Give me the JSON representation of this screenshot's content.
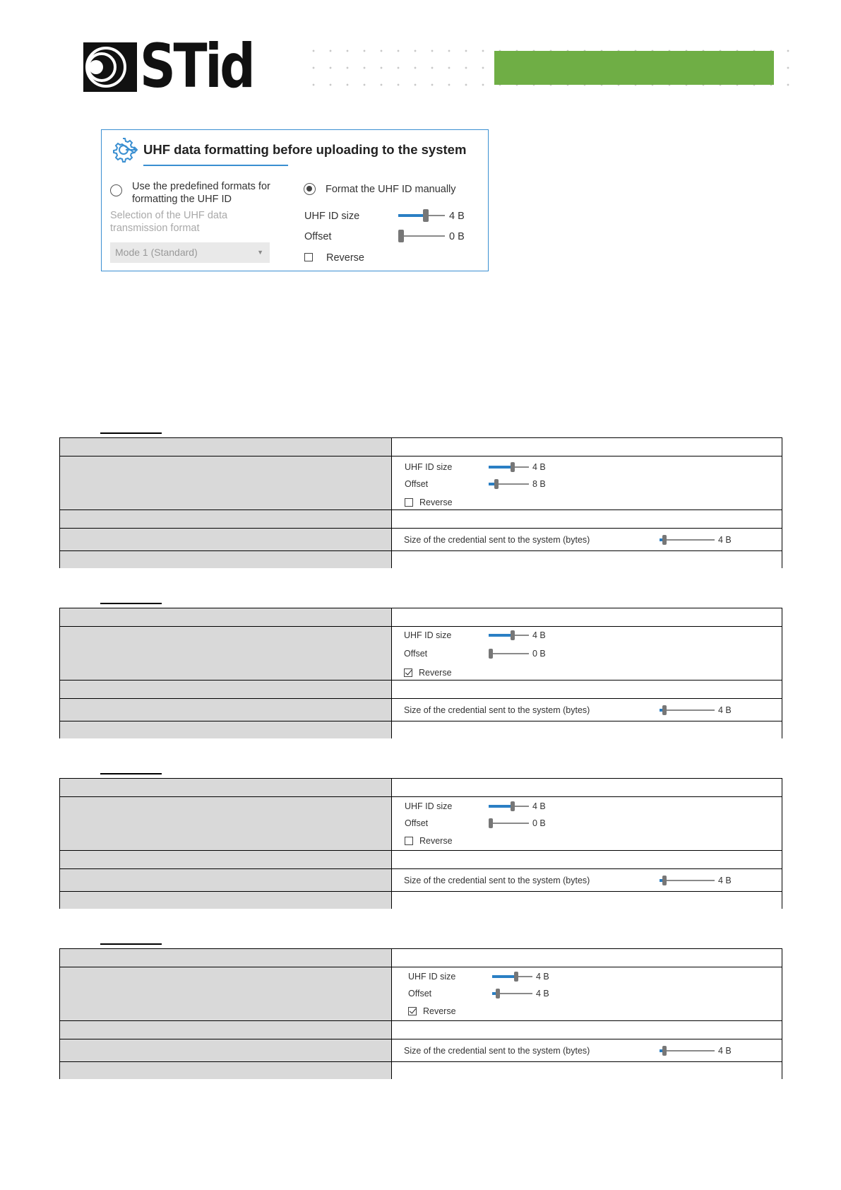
{
  "header": {
    "logo_text": "STid",
    "accent_color": "#6fae45"
  },
  "panel": {
    "title": "UHF data formatting before uploading to the system",
    "option_predefined": "Use the predefined formats for formatting the UHF ID",
    "option_manual": "Format the UHF ID manually",
    "selected_option": "manual",
    "selection_label": "Selection of the UHF data transmission format",
    "mode_value": "Mode 1 (Standard)",
    "uhf_id_size_label": "UHF ID size",
    "uhf_id_size_value": "4 B",
    "uhf_id_size_fraction": 0.6,
    "offset_label": "Offset",
    "offset_value": "0 B",
    "offset_fraction": 0.0,
    "reverse_label": "Reverse",
    "reverse_checked": false,
    "border_color": "#3a8fd1"
  },
  "tables": [
    {
      "uhf_id_size_label": "UHF ID size",
      "uhf_id_size_value": "4 B",
      "uhf_id_size_fraction": 0.6,
      "offset_label": "Offset",
      "offset_value": "8 B",
      "offset_fraction": 0.15,
      "reverse_label": "Reverse",
      "reverse_checked": false,
      "credential_label": "Size of the credential sent to the system (bytes)",
      "credential_value": "4 B",
      "credential_fraction": 0.05
    },
    {
      "uhf_id_size_label": "UHF ID size",
      "uhf_id_size_value": "4 B",
      "uhf_id_size_fraction": 0.6,
      "offset_label": "Offset",
      "offset_value": "0 B",
      "offset_fraction": 0.0,
      "reverse_label": "Reverse",
      "reverse_checked": true,
      "credential_label": "Size of the credential sent to the system (bytes)",
      "credential_value": "4 B",
      "credential_fraction": 0.05
    },
    {
      "uhf_id_size_label": "UHF ID size",
      "uhf_id_size_value": "4 B",
      "uhf_id_size_fraction": 0.6,
      "offset_label": "Offset",
      "offset_value": "0 B",
      "offset_fraction": 0.0,
      "reverse_label": "Reverse",
      "reverse_checked": false,
      "credential_label": "Size of the credential sent to the system (bytes)",
      "credential_value": "4 B",
      "credential_fraction": 0.05
    },
    {
      "uhf_id_size_label": "UHF ID size",
      "uhf_id_size_value": "4 B",
      "uhf_id_size_fraction": 0.6,
      "offset_label": "Offset",
      "offset_value": "4 B",
      "offset_fraction": 0.1,
      "reverse_label": "Reverse",
      "reverse_checked": true,
      "credential_label": "Size of the credential sent to the system (bytes)",
      "credential_value": "4 B",
      "credential_fraction": 0.05
    }
  ]
}
